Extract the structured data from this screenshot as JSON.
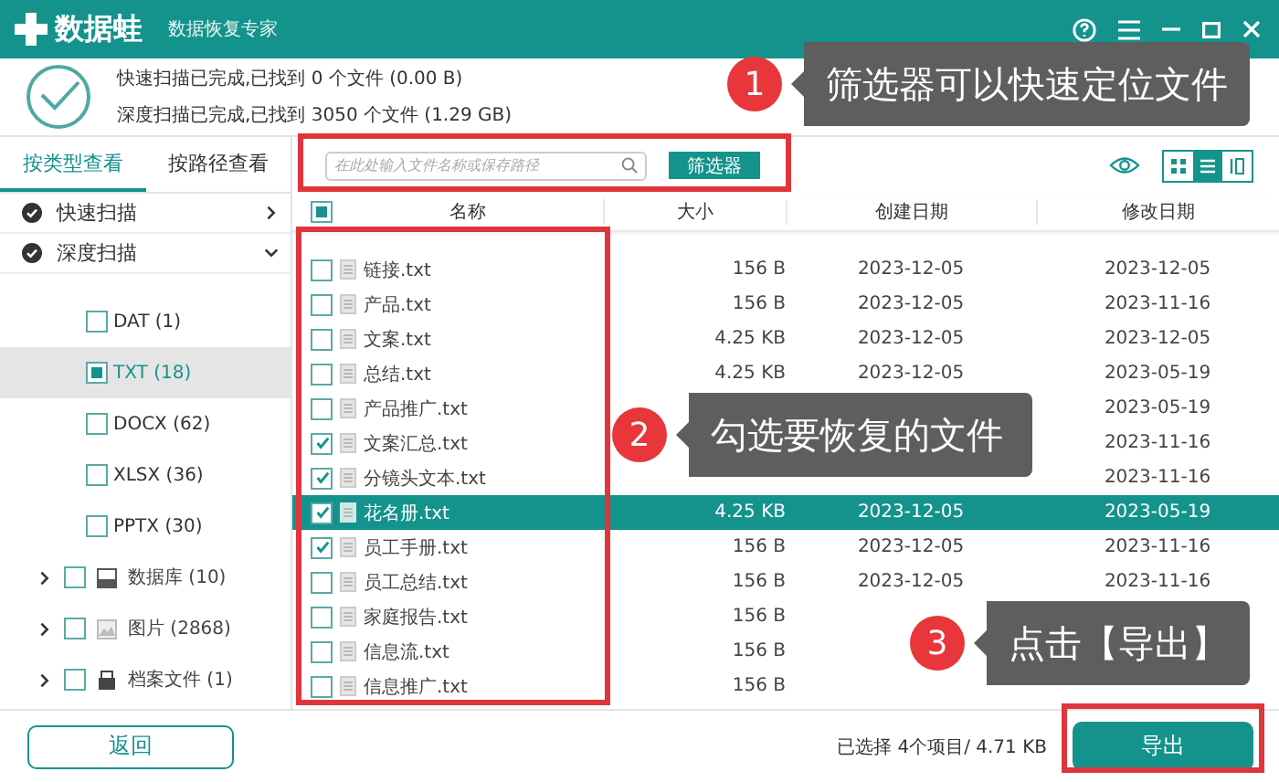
{
  "app": {
    "name": "数据蛙",
    "subtitle": "数据恢复专家"
  },
  "status": [
    "快速扫描已完成,已找到 0 个文件 (0.00  B)",
    "深度扫描已完成,已找到 3050 个文件 (1.29 GB)"
  ],
  "tabs": [
    {
      "label": "按类型查看",
      "selected": true
    },
    {
      "label": "按路径查看",
      "selected": false
    }
  ],
  "tree": [
    {
      "label": "快速扫描",
      "expanded": false
    },
    {
      "label": "深度扫描",
      "expanded": true,
      "children": [
        {
          "children": [
            {
              "label": "DAT (1)",
              "checked": false,
              "partial": false,
              "selected": false
            },
            {
              "label": "TXT (18)",
              "checked": false,
              "partial": true,
              "selected": true
            },
            {
              "label": "DOCX (62)",
              "checked": false,
              "partial": false,
              "selected": false
            },
            {
              "label": "XLSX (36)",
              "checked": false,
              "partial": false,
              "selected": false
            },
            {
              "label": "PPTX (30)",
              "checked": false,
              "partial": false,
              "selected": false
            }
          ]
        },
        {
          "label": "数据库 (10)",
          "kind": "database",
          "expanded": false,
          "checked": false
        },
        {
          "label": "图片 (2868)",
          "kind": "image",
          "expanded": false,
          "checked": false
        },
        {
          "label": "档案文件 (1)",
          "kind": "archive",
          "expanded": false,
          "checked": false
        }
      ]
    }
  ],
  "search": {
    "placeholder": "在此处输入文件名称或保存路径"
  },
  "filter_button": "筛选器",
  "view_modes": [
    {
      "kind": "grid",
      "selected": false
    },
    {
      "kind": "list",
      "selected": true
    },
    {
      "kind": "columns",
      "selected": false
    }
  ],
  "table": {
    "select_all_partial": true,
    "columns": [
      "名称",
      "大小",
      "创建日期",
      "修改日期"
    ],
    "rows": [
      {
        "name": "链接.txt",
        "size": "156  B",
        "created": "2023-12-05",
        "modified": "2023-12-05",
        "checked": false,
        "selected": false
      },
      {
        "name": "产品.txt",
        "size": "156  B",
        "created": "2023-12-05",
        "modified": "2023-11-16",
        "checked": false,
        "selected": false
      },
      {
        "name": "文案.txt",
        "size": "4.25 KB",
        "created": "2023-12-05",
        "modified": "2023-12-05",
        "checked": false,
        "selected": false
      },
      {
        "name": "总结.txt",
        "size": "4.25 KB",
        "created": "2023-12-05",
        "modified": "2023-05-19",
        "checked": false,
        "selected": false
      },
      {
        "name": "产品推广.txt",
        "modified": "2023-05-19",
        "checked": false,
        "selected": false
      },
      {
        "name": "文案汇总.txt",
        "modified": "2023-11-16",
        "checked": true,
        "selected": false
      },
      {
        "name": "分镜头文本.txt",
        "modified": "2023-11-16",
        "checked": true,
        "selected": false
      },
      {
        "name": "花名册.txt",
        "size": "4.25 KB",
        "created": "2023-12-05",
        "modified": "2023-05-19",
        "checked": true,
        "selected": true
      },
      {
        "name": "员工手册.txt",
        "size": "156  B",
        "created": "2023-12-05",
        "modified": "2023-11-16",
        "checked": true,
        "selected": false
      },
      {
        "name": "员工总结.txt",
        "size": "156  B",
        "created": "2023-12-05",
        "modified": "2023-11-16",
        "checked": false,
        "selected": false
      },
      {
        "name": "家庭报告.txt",
        "size": "156  B",
        "checked": false,
        "selected": false
      },
      {
        "name": "信息流.txt",
        "size": "156  B",
        "checked": false,
        "selected": false
      },
      {
        "name": "信息推广.txt",
        "size": "156  B",
        "checked": false,
        "selected": false
      }
    ]
  },
  "back_button": "返回",
  "selection_summary": "已选择 4个项目/ 4.71 KB",
  "export_button": "导出",
  "annotations": [
    {
      "number": "1",
      "text": "筛选器可以快速定位文件"
    },
    {
      "number": "2",
      "text": "勾选要恢复的文件"
    },
    {
      "number": "3",
      "text": "点击【导出】"
    }
  ]
}
